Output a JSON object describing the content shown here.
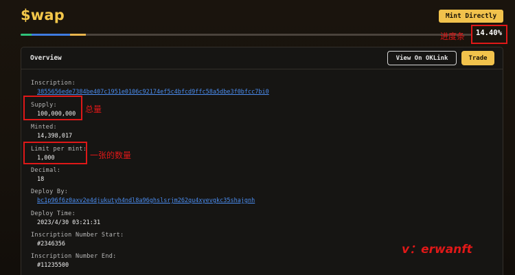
{
  "header": {
    "title": "$wap",
    "mint_label": "Mint Directly",
    "progress": {
      "percent_label": "14.40%",
      "value": 0.144
    }
  },
  "annotations": {
    "progress": "进度条",
    "supply": "总量",
    "limit": "一张的数量",
    "watermark": "v：erwanft"
  },
  "overview": {
    "title": "Overview",
    "view_label": "View On OKLink",
    "trade_label": "Trade",
    "fields": {
      "inscription": {
        "label": "Inscription:",
        "value": "3855656ede7384be407c1951e0106c92174ef5c4bfcd9ffc58a5dbe3f0bfcc7bi0"
      },
      "supply": {
        "label": "Supply:",
        "value": "100,000,000"
      },
      "minted": {
        "label": "Minted:",
        "value": "14,398,017"
      },
      "limit": {
        "label": "Limit per mint:",
        "value": "1,000"
      },
      "decimal": {
        "label": "Decimal:",
        "value": "18"
      },
      "deploy_by": {
        "label": "Deploy By:",
        "value": "bc1p96f6z0axv2e4djukutyh4ndl8a96ghslsrjm262qu4xyevgkc35shajgnh"
      },
      "deploy_time": {
        "label": "Deploy Time:",
        "value": "2023/4/30 03:21:31"
      },
      "num_start": {
        "label": "Inscription Number Start:",
        "value": "#2346356"
      },
      "num_end": {
        "label": "Inscription Number End:",
        "value": "#11235500"
      }
    }
  },
  "colors": {
    "accent": "#f1c24c",
    "link": "#4b8df0",
    "annotation": "#e01818",
    "progress_segments": [
      "#2fc37a",
      "#3f7be0",
      "#e9b54d"
    ]
  }
}
